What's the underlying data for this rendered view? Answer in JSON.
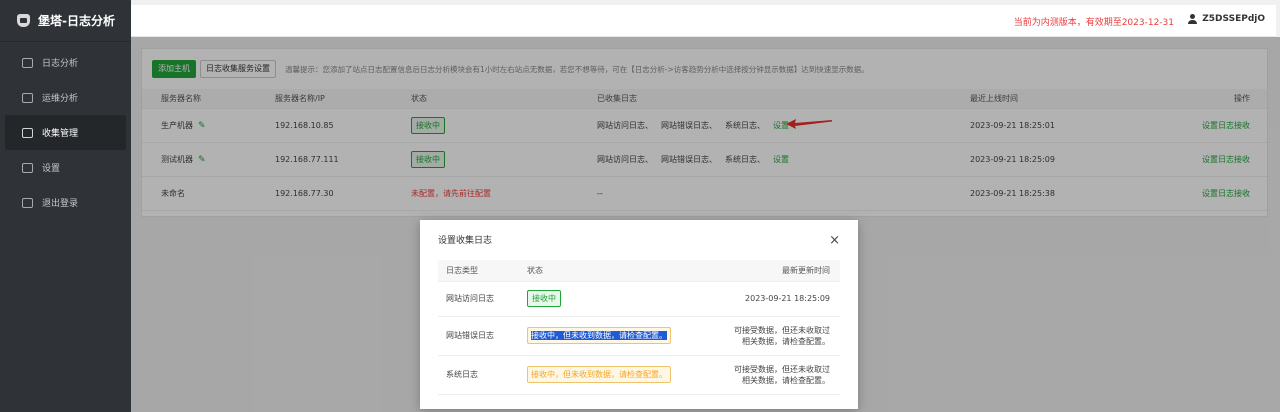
{
  "sidebar": {
    "brand": "堡塔-日志分析",
    "items": [
      {
        "label": "日志分析",
        "icon": "document-icon"
      },
      {
        "label": "运维分析",
        "icon": "monitor-icon"
      },
      {
        "label": "收集管理",
        "icon": "clipboard-icon"
      },
      {
        "label": "设置",
        "icon": "settings-icon"
      },
      {
        "label": "退出登录",
        "icon": "logout-icon"
      }
    ],
    "active": "收集管理"
  },
  "topbar": {
    "notice": "当前为内测版本，有效期至2023-12-31",
    "username": "Z5DSSEPdjO"
  },
  "toolbar": {
    "add_host": "添加主机",
    "log_service_settings": "日志收集服务设置",
    "tip": "温馨提示：您添加了站点日志配置信息后日志分析模块会有1小时左右站点无数据，若您不想等待，可在【日志分析->访客趋势分析中选择按分钟显示数据】达到快速显示数据。"
  },
  "table": {
    "headers": [
      "服务器名称",
      "服务器名称/IP",
      "状态",
      "已收集日志",
      "最近上线时间",
      "操作"
    ],
    "rows": [
      {
        "name": "生产机器",
        "ip": "192.168.10.85",
        "status": "接收中",
        "status_type": "ok",
        "logs": [
          "网站访问日志、",
          "网站错误日志、",
          "系统日志、"
        ],
        "logs_link": "设置",
        "last_online": "2023-09-21 18:25:01",
        "action": "设置日志接收"
      },
      {
        "name": "测试机器",
        "ip": "192.168.77.111",
        "status": "接收中",
        "status_type": "ok",
        "logs": [
          "网站访问日志、",
          "网站错误日志、",
          "系统日志、"
        ],
        "logs_link": "设置",
        "last_online": "2023-09-21 18:25:09",
        "action": "设置日志接收"
      },
      {
        "name": "未命名",
        "ip": "192.168.77.30",
        "status": "未配置，请先前往配置",
        "status_type": "error",
        "logs": [
          "--"
        ],
        "logs_link": "",
        "last_online": "2023-09-21 18:25:38",
        "action": "设置日志接收"
      }
    ]
  },
  "modal": {
    "title": "设置收集日志",
    "close": "×",
    "headers": [
      "日志类型",
      "状态",
      "最新更新时间"
    ],
    "rows": [
      {
        "type": "网站访问日志",
        "status": "接收中",
        "updated_line1": "2023-09-21 18:25:09",
        "updated_line2": ""
      },
      {
        "type": "网站错误日志",
        "status": "接收中，但未收到数据，请检查配置。",
        "updated_line1": "可接受数据，但还未收取过",
        "updated_line2": "相关数据，请检查配置。"
      },
      {
        "type": "系统日志",
        "status": "接收中，但未收到数据，请检查配置。",
        "updated_line1": "可接受数据，但还未收取过",
        "updated_line2": "相关数据，请检查配置。"
      }
    ]
  },
  "colors": {
    "accent_green": "#20a53a",
    "error_red": "#ef3b3b",
    "warn_orange": "#f5a623",
    "sidebar_bg": "#2f3337"
  }
}
